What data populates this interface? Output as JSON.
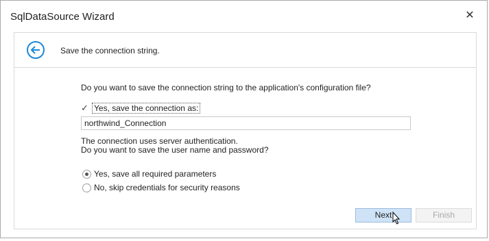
{
  "window": {
    "title": "SqlDataSource Wizard",
    "close_glyph": "✕",
    "close_icon": "close-icon"
  },
  "header": {
    "back_icon": "back-arrow-circle-icon",
    "text": "Save the connection string."
  },
  "body": {
    "question": "Do you want to save the connection string to the application's configuration file?",
    "save_checkbox": {
      "checked": true,
      "glyph": "✓",
      "label": "Yes, save the connection as:"
    },
    "connection_name": {
      "value": "northwind_Connection"
    },
    "info_line1": "The connection uses server authentication.",
    "info_line2": "Do you want to save the user name and password?",
    "radio_options": [
      {
        "label": "Yes, save all required parameters",
        "selected": true
      },
      {
        "label": "No, skip credentials for security reasons",
        "selected": false
      }
    ]
  },
  "buttons": {
    "next_label": "Next",
    "finish_label": "Finish",
    "finish_enabled": false
  },
  "colors": {
    "accent": "#1a88d9",
    "next_button_bg": "#cfe3f7"
  },
  "cursor_icon": "hand-pointer-icon"
}
